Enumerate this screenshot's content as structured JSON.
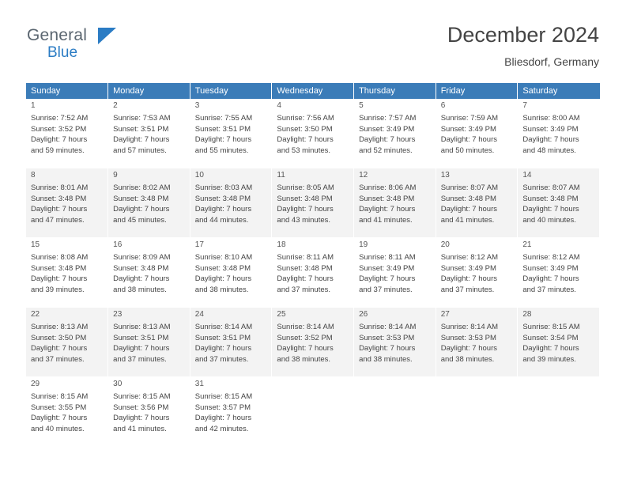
{
  "brand": {
    "line1": "General",
    "line2": "Blue",
    "flag_icon": "blue-flag-icon"
  },
  "header": {
    "title": "December 2024",
    "subtitle": "Bliesdorf, Germany"
  },
  "colors": {
    "header_row": "#3b7cb8",
    "brand_blue": "#2b7cc4",
    "shaded_row": "#f3f3f3",
    "text": "#444444"
  },
  "weekdays": [
    "Sunday",
    "Monday",
    "Tuesday",
    "Wednesday",
    "Thursday",
    "Friday",
    "Saturday"
  ],
  "weeks": [
    {
      "shaded": false,
      "days": [
        {
          "num": "1",
          "sunrise": "Sunrise: 7:52 AM",
          "sunset": "Sunset: 3:52 PM",
          "daylight1": "Daylight: 7 hours",
          "daylight2": "and 59 minutes."
        },
        {
          "num": "2",
          "sunrise": "Sunrise: 7:53 AM",
          "sunset": "Sunset: 3:51 PM",
          "daylight1": "Daylight: 7 hours",
          "daylight2": "and 57 minutes."
        },
        {
          "num": "3",
          "sunrise": "Sunrise: 7:55 AM",
          "sunset": "Sunset: 3:51 PM",
          "daylight1": "Daylight: 7 hours",
          "daylight2": "and 55 minutes."
        },
        {
          "num": "4",
          "sunrise": "Sunrise: 7:56 AM",
          "sunset": "Sunset: 3:50 PM",
          "daylight1": "Daylight: 7 hours",
          "daylight2": "and 53 minutes."
        },
        {
          "num": "5",
          "sunrise": "Sunrise: 7:57 AM",
          "sunset": "Sunset: 3:49 PM",
          "daylight1": "Daylight: 7 hours",
          "daylight2": "and 52 minutes."
        },
        {
          "num": "6",
          "sunrise": "Sunrise: 7:59 AM",
          "sunset": "Sunset: 3:49 PM",
          "daylight1": "Daylight: 7 hours",
          "daylight2": "and 50 minutes."
        },
        {
          "num": "7",
          "sunrise": "Sunrise: 8:00 AM",
          "sunset": "Sunset: 3:49 PM",
          "daylight1": "Daylight: 7 hours",
          "daylight2": "and 48 minutes."
        }
      ]
    },
    {
      "shaded": true,
      "days": [
        {
          "num": "8",
          "sunrise": "Sunrise: 8:01 AM",
          "sunset": "Sunset: 3:48 PM",
          "daylight1": "Daylight: 7 hours",
          "daylight2": "and 47 minutes."
        },
        {
          "num": "9",
          "sunrise": "Sunrise: 8:02 AM",
          "sunset": "Sunset: 3:48 PM",
          "daylight1": "Daylight: 7 hours",
          "daylight2": "and 45 minutes."
        },
        {
          "num": "10",
          "sunrise": "Sunrise: 8:03 AM",
          "sunset": "Sunset: 3:48 PM",
          "daylight1": "Daylight: 7 hours",
          "daylight2": "and 44 minutes."
        },
        {
          "num": "11",
          "sunrise": "Sunrise: 8:05 AM",
          "sunset": "Sunset: 3:48 PM",
          "daylight1": "Daylight: 7 hours",
          "daylight2": "and 43 minutes."
        },
        {
          "num": "12",
          "sunrise": "Sunrise: 8:06 AM",
          "sunset": "Sunset: 3:48 PM",
          "daylight1": "Daylight: 7 hours",
          "daylight2": "and 41 minutes."
        },
        {
          "num": "13",
          "sunrise": "Sunrise: 8:07 AM",
          "sunset": "Sunset: 3:48 PM",
          "daylight1": "Daylight: 7 hours",
          "daylight2": "and 41 minutes."
        },
        {
          "num": "14",
          "sunrise": "Sunrise: 8:07 AM",
          "sunset": "Sunset: 3:48 PM",
          "daylight1": "Daylight: 7 hours",
          "daylight2": "and 40 minutes."
        }
      ]
    },
    {
      "shaded": false,
      "days": [
        {
          "num": "15",
          "sunrise": "Sunrise: 8:08 AM",
          "sunset": "Sunset: 3:48 PM",
          "daylight1": "Daylight: 7 hours",
          "daylight2": "and 39 minutes."
        },
        {
          "num": "16",
          "sunrise": "Sunrise: 8:09 AM",
          "sunset": "Sunset: 3:48 PM",
          "daylight1": "Daylight: 7 hours",
          "daylight2": "and 38 minutes."
        },
        {
          "num": "17",
          "sunrise": "Sunrise: 8:10 AM",
          "sunset": "Sunset: 3:48 PM",
          "daylight1": "Daylight: 7 hours",
          "daylight2": "and 38 minutes."
        },
        {
          "num": "18",
          "sunrise": "Sunrise: 8:11 AM",
          "sunset": "Sunset: 3:48 PM",
          "daylight1": "Daylight: 7 hours",
          "daylight2": "and 37 minutes."
        },
        {
          "num": "19",
          "sunrise": "Sunrise: 8:11 AM",
          "sunset": "Sunset: 3:49 PM",
          "daylight1": "Daylight: 7 hours",
          "daylight2": "and 37 minutes."
        },
        {
          "num": "20",
          "sunrise": "Sunrise: 8:12 AM",
          "sunset": "Sunset: 3:49 PM",
          "daylight1": "Daylight: 7 hours",
          "daylight2": "and 37 minutes."
        },
        {
          "num": "21",
          "sunrise": "Sunrise: 8:12 AM",
          "sunset": "Sunset: 3:49 PM",
          "daylight1": "Daylight: 7 hours",
          "daylight2": "and 37 minutes."
        }
      ]
    },
    {
      "shaded": true,
      "days": [
        {
          "num": "22",
          "sunrise": "Sunrise: 8:13 AM",
          "sunset": "Sunset: 3:50 PM",
          "daylight1": "Daylight: 7 hours",
          "daylight2": "and 37 minutes."
        },
        {
          "num": "23",
          "sunrise": "Sunrise: 8:13 AM",
          "sunset": "Sunset: 3:51 PM",
          "daylight1": "Daylight: 7 hours",
          "daylight2": "and 37 minutes."
        },
        {
          "num": "24",
          "sunrise": "Sunrise: 8:14 AM",
          "sunset": "Sunset: 3:51 PM",
          "daylight1": "Daylight: 7 hours",
          "daylight2": "and 37 minutes."
        },
        {
          "num": "25",
          "sunrise": "Sunrise: 8:14 AM",
          "sunset": "Sunset: 3:52 PM",
          "daylight1": "Daylight: 7 hours",
          "daylight2": "and 38 minutes."
        },
        {
          "num": "26",
          "sunrise": "Sunrise: 8:14 AM",
          "sunset": "Sunset: 3:53 PM",
          "daylight1": "Daylight: 7 hours",
          "daylight2": "and 38 minutes."
        },
        {
          "num": "27",
          "sunrise": "Sunrise: 8:14 AM",
          "sunset": "Sunset: 3:53 PM",
          "daylight1": "Daylight: 7 hours",
          "daylight2": "and 38 minutes."
        },
        {
          "num": "28",
          "sunrise": "Sunrise: 8:15 AM",
          "sunset": "Sunset: 3:54 PM",
          "daylight1": "Daylight: 7 hours",
          "daylight2": "and 39 minutes."
        }
      ]
    },
    {
      "shaded": false,
      "days": [
        {
          "num": "29",
          "sunrise": "Sunrise: 8:15 AM",
          "sunset": "Sunset: 3:55 PM",
          "daylight1": "Daylight: 7 hours",
          "daylight2": "and 40 minutes."
        },
        {
          "num": "30",
          "sunrise": "Sunrise: 8:15 AM",
          "sunset": "Sunset: 3:56 PM",
          "daylight1": "Daylight: 7 hours",
          "daylight2": "and 41 minutes."
        },
        {
          "num": "31",
          "sunrise": "Sunrise: 8:15 AM",
          "sunset": "Sunset: 3:57 PM",
          "daylight1": "Daylight: 7 hours",
          "daylight2": "and 42 minutes."
        },
        null,
        null,
        null,
        null
      ]
    }
  ]
}
